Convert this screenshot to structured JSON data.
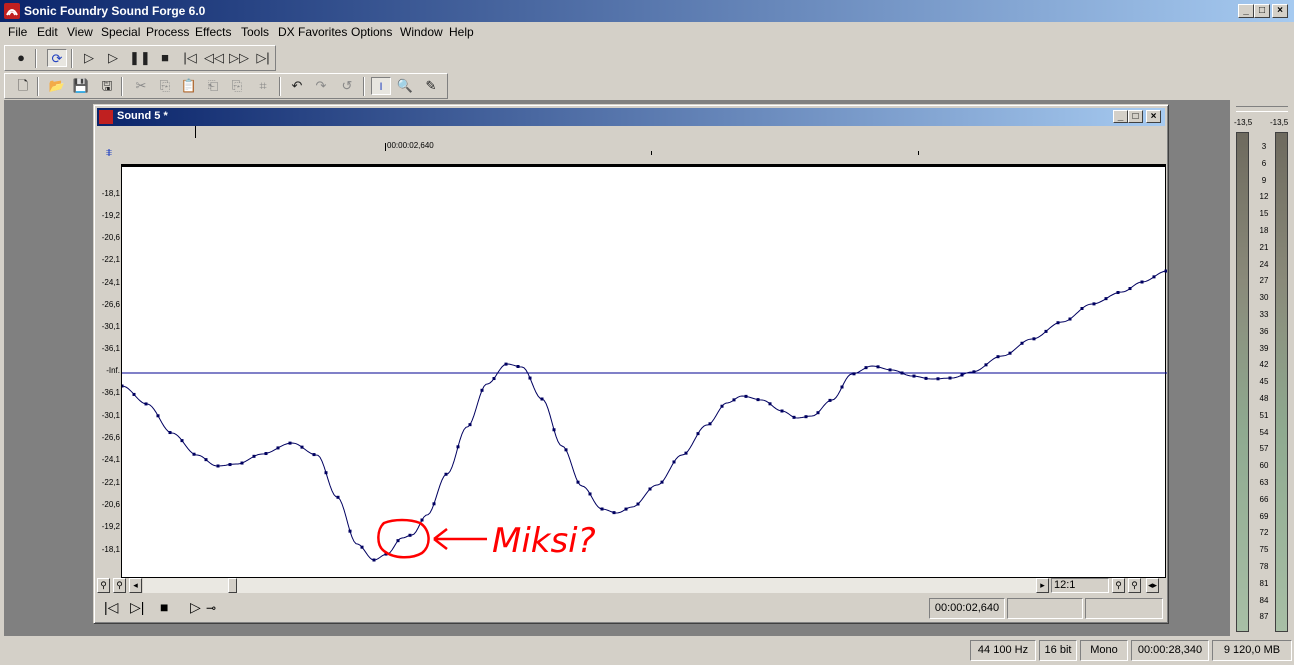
{
  "app": {
    "title": "Sonic Foundry Sound Forge 6.0",
    "window_buttons": [
      "_",
      "□",
      "×"
    ]
  },
  "menu": {
    "items": [
      "File",
      "Edit",
      "View",
      "Special",
      "Process",
      "Effects",
      "Tools",
      "DX Favorites",
      "Options",
      "Window",
      "Help"
    ]
  },
  "child_window": {
    "title": "Sound 5 *",
    "time_marker": "00:00:02,640",
    "db_labels": [
      "-18,1",
      "-19,2",
      "-20,6",
      "-22,1",
      "-24,1",
      "-26,6",
      "-30,1",
      "-36,1",
      "-Inf.",
      "-36,1",
      "-30,1",
      "-26,6",
      "-24,1",
      "-22,1",
      "-20,6",
      "-19,2",
      "-18,1"
    ],
    "zoom_ratio": "12:1",
    "position": "00:00:02,640",
    "annotation": "Miksi?"
  },
  "status": {
    "sample_rate": "44 100 Hz",
    "bit_depth": "16 bit",
    "channels": "Mono",
    "length": "00:00:28,340",
    "free_space": "9 120,0 MB"
  },
  "meters": {
    "peak_left": "-13,5",
    "peak_right": "-13,5",
    "scale": [
      "3",
      "6",
      "9",
      "12",
      "15",
      "18",
      "21",
      "24",
      "27",
      "30",
      "33",
      "36",
      "39",
      "42",
      "45",
      "48",
      "51",
      "54",
      "57",
      "60",
      "63",
      "66",
      "69",
      "72",
      "75",
      "78",
      "81",
      "84",
      "87"
    ]
  },
  "colors": {
    "titlebar_start": "#0a246a",
    "titlebar_end": "#a6caf0",
    "waveform": "#000060",
    "annotation": "#ff0000"
  }
}
